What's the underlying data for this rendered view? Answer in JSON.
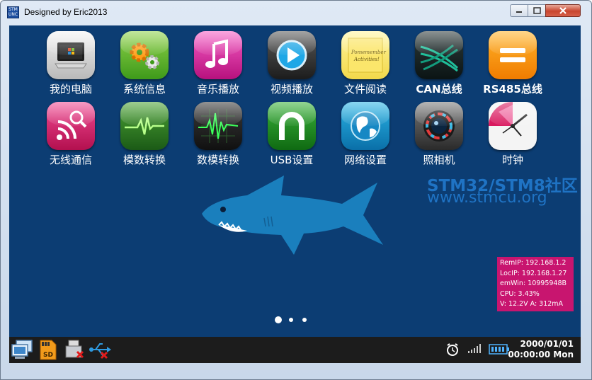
{
  "window": {
    "title": "Designed by Eric2013",
    "app_icon_text": "STM UNC"
  },
  "apps_row1": [
    {
      "label": "我的电脑",
      "icon": "computer-icon"
    },
    {
      "label": "系统信息",
      "icon": "gears-icon"
    },
    {
      "label": "音乐播放",
      "icon": "music-note-icon"
    },
    {
      "label": "视频播放",
      "icon": "play-icon"
    },
    {
      "label": "文件阅读",
      "icon": "sticky-note-icon"
    },
    {
      "label": "CAN总线",
      "icon": "can-bus-icon"
    },
    {
      "label": "RS485总线",
      "icon": "equals-icon"
    }
  ],
  "apps_row2": [
    {
      "label": "无线通信",
      "icon": "wireless-icon"
    },
    {
      "label": "模数转换",
      "icon": "waveform-icon"
    },
    {
      "label": "数模转换",
      "icon": "oscilloscope-icon"
    },
    {
      "label": "USB设置",
      "icon": "usb-arch-icon"
    },
    {
      "label": "网络设置",
      "icon": "globe-icon"
    },
    {
      "label": "照相机",
      "icon": "camera-lens-icon"
    },
    {
      "label": "时钟",
      "icon": "clock-icon"
    }
  ],
  "watermark": {
    "line1": "STM32/STM8社区",
    "line2": "www.stmcu.org"
  },
  "sticky_note_text": "Pomemember Activities!",
  "sd_label": "SD",
  "status": {
    "rem_ip": "RemIP: 192.168.1.2",
    "loc_ip": "LocIP: 192.168.1.27",
    "emwin": "emWin: 10995948B",
    "cpu": "CPU:  3.43%",
    "power": "V: 12.2V    A: 312mA"
  },
  "pager": {
    "pages": 3,
    "active": 1
  },
  "taskbar": {
    "left_icons": [
      "network-computers-icon",
      "sd-card-icon",
      "usb-drive-disconnected-icon",
      "usb-disconnected-icon"
    ],
    "right_icons": [
      "alarm-clock-icon",
      "signal-bars-icon",
      "battery-icon"
    ],
    "date": "2000/01/01",
    "time": "00:00:00 Mon"
  },
  "colors": {
    "desktop": "#0c3d73",
    "info_box": "#c8156f",
    "taskbar": "#1c1c1c",
    "watermark": "#1f73c4",
    "shark": "#1a7fbd"
  }
}
